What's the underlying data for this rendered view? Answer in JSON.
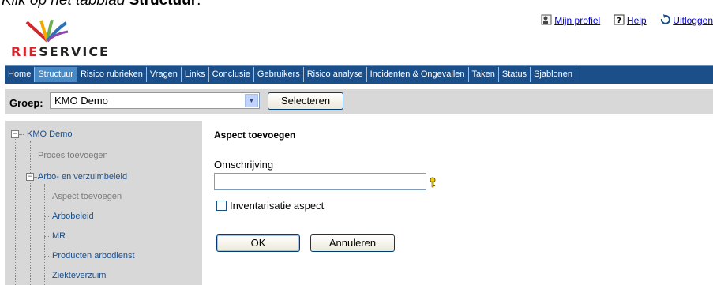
{
  "caption": {
    "prefix": "Klik op het tabblad ",
    "bold": "Structuur",
    "suffix": "."
  },
  "logo": {
    "text_red": "RIE",
    "text_dark": "SERVICE"
  },
  "toplinks": {
    "profile": "Mijn profiel",
    "help": "Help",
    "logout": "Uitloggen"
  },
  "tabs": [
    "Home",
    "Structuur",
    "Risico rubrieken",
    "Vragen",
    "Links",
    "Conclusie",
    "Gebruikers",
    "Risico analyse",
    "Incidenten & Ongevallen",
    "Taken",
    "Status",
    "Sjablonen"
  ],
  "active_tab": "Structuur",
  "group": {
    "label": "Groep:",
    "selected": "KMO Demo",
    "button": "Selecteren"
  },
  "tree": {
    "root": "KMO Demo",
    "add_process": "Proces toevoegen",
    "node": "Arbo- en verzuimbeleid",
    "children": [
      "Aspect toevoegen",
      "Arbobeleid",
      "MR",
      "Producten arbodienst",
      "Ziekteverzuim"
    ]
  },
  "form": {
    "title": "Aspect toevoegen",
    "field_label": "Omschrijving",
    "field_value": "",
    "checkbox_label": "Inventarisatie aspect",
    "ok": "OK",
    "cancel": "Annuleren"
  },
  "colors": {
    "nav": "#1b4f8a",
    "active_tab": "#4a8ac4",
    "panel": "#d8d8d8",
    "brand_red": "#d1262c"
  }
}
